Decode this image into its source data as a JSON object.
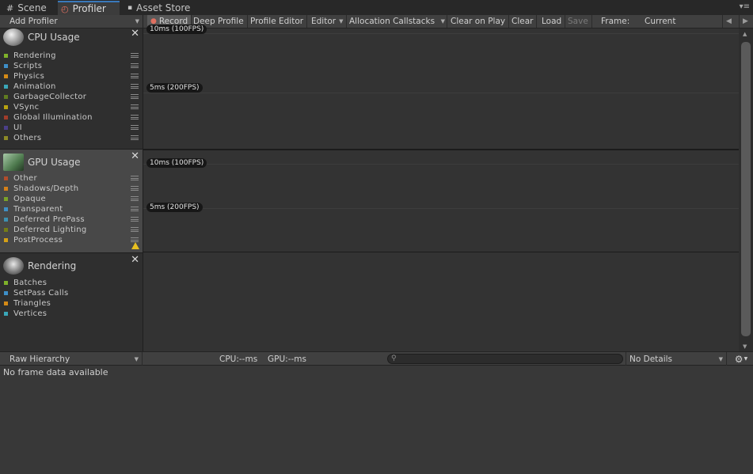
{
  "tabs": [
    {
      "label": "Scene",
      "icon": "grid-icon"
    },
    {
      "label": "Profiler",
      "icon": "profiler-icon"
    },
    {
      "label": "Asset Store",
      "icon": "lock-icon"
    }
  ],
  "toolbar": {
    "add_profiler": "Add Profiler",
    "record": "Record",
    "deep_profile": "Deep Profile",
    "profile_editor": "Profile Editor",
    "editor": "Editor",
    "allocation_callstacks": "Allocation Callstacks",
    "clear_on_play": "Clear on Play",
    "clear": "Clear",
    "load": "Load",
    "save": "Save",
    "frame_label": "Frame:",
    "frame_value": "Current"
  },
  "modules": {
    "cpu": {
      "title": "CPU Usage",
      "items": [
        {
          "label": "Rendering",
          "color": "#7fb22a"
        },
        {
          "label": "Scripts",
          "color": "#3e8fc8"
        },
        {
          "label": "Physics",
          "color": "#d48a16"
        },
        {
          "label": "Animation",
          "color": "#3aa7b8"
        },
        {
          "label": "GarbageCollector",
          "color": "#607c20"
        },
        {
          "label": "VSync",
          "color": "#b8a310"
        },
        {
          "label": "Global Illumination",
          "color": "#a13c2a"
        },
        {
          "label": "UI",
          "color": "#4b3f8a"
        },
        {
          "label": "Others",
          "color": "#8c8a26"
        }
      ],
      "graph_labels": [
        "10ms (100FPS)",
        "5ms (200FPS)"
      ]
    },
    "gpu": {
      "title": "GPU Usage",
      "items": [
        {
          "label": "Other",
          "color": "#b14d2c"
        },
        {
          "label": "Shadows/Depth",
          "color": "#d4801a"
        },
        {
          "label": "Opaque",
          "color": "#7ca228"
        },
        {
          "label": "Transparent",
          "color": "#3f8fc4"
        },
        {
          "label": "Deferred PrePass",
          "color": "#3e8fb0"
        },
        {
          "label": "Deferred Lighting",
          "color": "#757c18"
        },
        {
          "label": "PostProcess",
          "color": "#d4a017"
        }
      ],
      "graph_labels": [
        "10ms (100FPS)",
        "5ms (200FPS)"
      ]
    },
    "rendering": {
      "title": "Rendering",
      "items": [
        {
          "label": "Batches",
          "color": "#7fb22a"
        },
        {
          "label": "SetPass Calls",
          "color": "#3e8fc8"
        },
        {
          "label": "Triangles",
          "color": "#d48a16"
        },
        {
          "label": "Vertices",
          "color": "#3aa7b8"
        }
      ]
    }
  },
  "details": {
    "view_mode": "Raw Hierarchy",
    "cpu_time": "CPU:--ms",
    "gpu_time": "GPU:--ms",
    "search_placeholder": "",
    "details_mode": "No Details",
    "empty_message": "No frame data available"
  }
}
